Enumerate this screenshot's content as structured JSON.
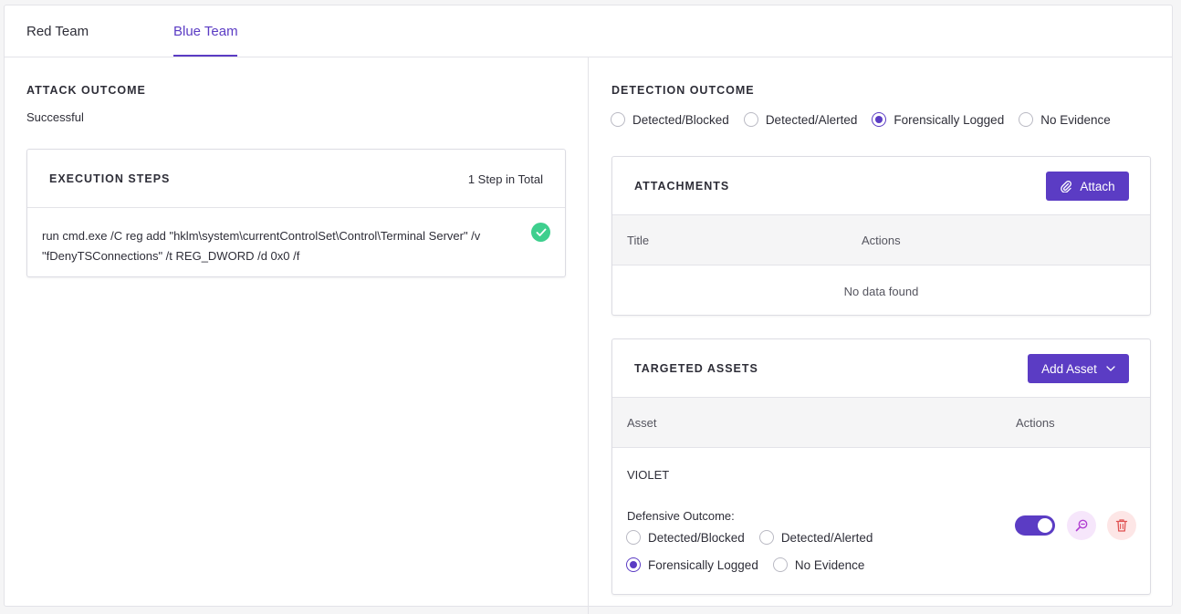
{
  "tabs": [
    {
      "label": "Red Team",
      "active": false
    },
    {
      "label": "Blue Team",
      "active": true
    }
  ],
  "left": {
    "attack_outcome_title": "ATTACK OUTCOME",
    "attack_outcome_value": "Successful",
    "execution": {
      "title": "EXECUTION STEPS",
      "count": "1 Step in Total",
      "steps": [
        {
          "text": "run cmd.exe /C reg add \"hklm\\system\\currentControlSet\\Control\\Terminal Server\" /v \"fDenyTSConnections\" /t REG_DWORD /d 0x0 /f",
          "status_icon": "check-circle-icon"
        }
      ]
    }
  },
  "right": {
    "detection_outcome_title": "DETECTION OUTCOME",
    "detection_options": [
      "Detected/Blocked",
      "Detected/Alerted",
      "Forensically Logged",
      "No Evidence"
    ],
    "detection_selected": "Forensically Logged",
    "attachments": {
      "title": "ATTACHMENTS",
      "attach_label": "Attach",
      "columns": [
        "Title",
        "Actions"
      ],
      "empty_text": "No data found"
    },
    "assets": {
      "title": "TARGETED ASSETS",
      "add_label": "Add Asset",
      "columns": [
        "Asset",
        "Actions"
      ],
      "rows": [
        {
          "name": "VIOLET",
          "outcome_label": "Defensive Outcome:",
          "options": [
            "Detected/Blocked",
            "Detected/Alerted",
            "Forensically Logged",
            "No Evidence"
          ],
          "selected": "Forensically Logged",
          "toggle_on": true
        }
      ]
    }
  },
  "colors": {
    "accent": "#5b3cc4",
    "success": "#3ecf8e",
    "delete": "#e05252",
    "inspect": "#b13fd1"
  }
}
